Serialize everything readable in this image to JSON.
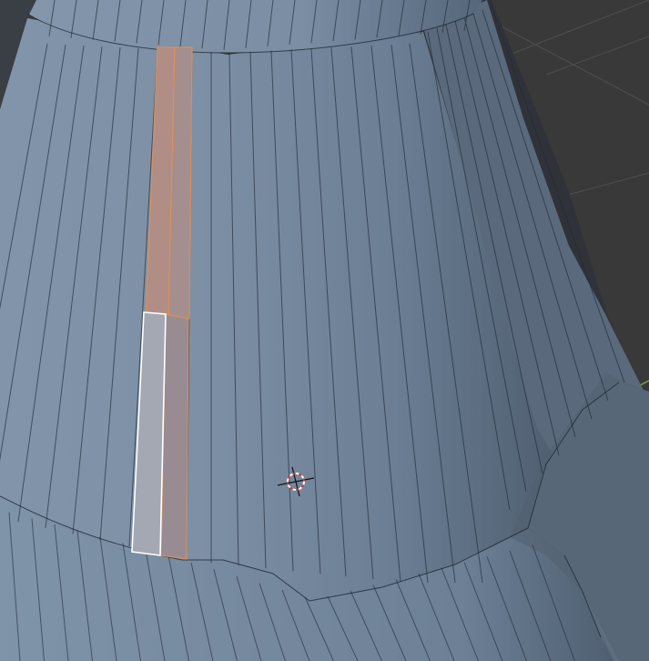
{
  "viewport": {
    "mode": "edit-mode",
    "background": "#393939",
    "grid_color": "#4d4d4d",
    "axis_color": "#6f9a3c"
  },
  "mesh": {
    "face_color": "#7a8da3",
    "face_shadow": "#4e5d6d",
    "face_dark": "#2f3339",
    "edge_color": "#1f2a35"
  },
  "selection": {
    "selected_faces": 3,
    "selected_color": "#d8905a",
    "active_face_outline": "#ffffff"
  },
  "cursor": {
    "icon": "3d-cursor-icon",
    "ring_red": "#d33a3a",
    "ring_white": "#ffffff"
  }
}
